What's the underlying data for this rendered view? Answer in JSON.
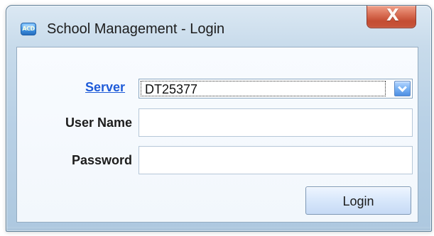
{
  "window": {
    "title": "School Management - Login",
    "app_icon_label": "ACD",
    "close_label": "X"
  },
  "form": {
    "server": {
      "label": "Server",
      "selected_value": "DT25377"
    },
    "username": {
      "label": "User Name",
      "value": "",
      "placeholder": ""
    },
    "password": {
      "label": "Password",
      "value": "",
      "placeholder": ""
    },
    "login_button_label": "Login"
  },
  "icons": {
    "app": "app-icon",
    "close": "close-icon",
    "dropdown": "chevron-down-icon"
  },
  "colors": {
    "window_frame": "#5f7f98",
    "title_bar": "#c8dbeb",
    "close_button": "#d96f55",
    "link": "#1f5bd8",
    "button": "#d9e8fb",
    "input_border": "#b6c7d8"
  }
}
